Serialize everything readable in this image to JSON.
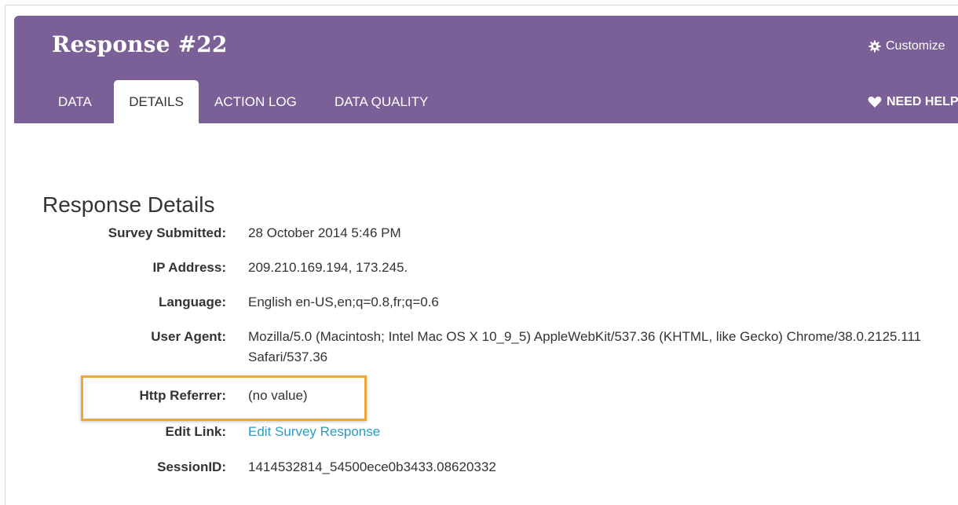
{
  "header": {
    "title": "Response #22",
    "customize_label": "Customize",
    "need_help_label": "NEED HELP",
    "tabs": [
      {
        "label": "DATA",
        "active": false
      },
      {
        "label": "DETAILS",
        "active": true
      },
      {
        "label": "ACTION LOG",
        "active": false
      },
      {
        "label": "DATA QUALITY",
        "active": false
      }
    ],
    "accent_color": "#7b5f97"
  },
  "details": {
    "title": "Response Details",
    "rows": [
      {
        "label": "Survey Submitted:",
        "value": "28 October 2014 5:46 PM"
      },
      {
        "label": "IP Address:",
        "value": "209.210.169.194, 173.245."
      },
      {
        "label": "Language:",
        "value": "English en-US,en;q=0.8,fr;q=0.6"
      },
      {
        "label": "User Agent:",
        "value": "Mozilla/5.0 (Macintosh; Intel Mac OS X 10_9_5) AppleWebKit/537.36 (KHTML, like Gecko) Chrome/38.0.2125.111 Safari/537.36"
      },
      {
        "label": "Http Referrer:",
        "value": "(no value)"
      },
      {
        "label": "Edit Link:",
        "value": "Edit Survey Response",
        "link": true
      },
      {
        "label": "SessionID:",
        "value": "1414532814_54500ece0b3433.08620332"
      }
    ],
    "highlight_color": "#f2a53a",
    "link_color": "#2b9dc0"
  },
  "icons": {
    "customize": "gear-icon",
    "need_help": "heart-icon"
  }
}
